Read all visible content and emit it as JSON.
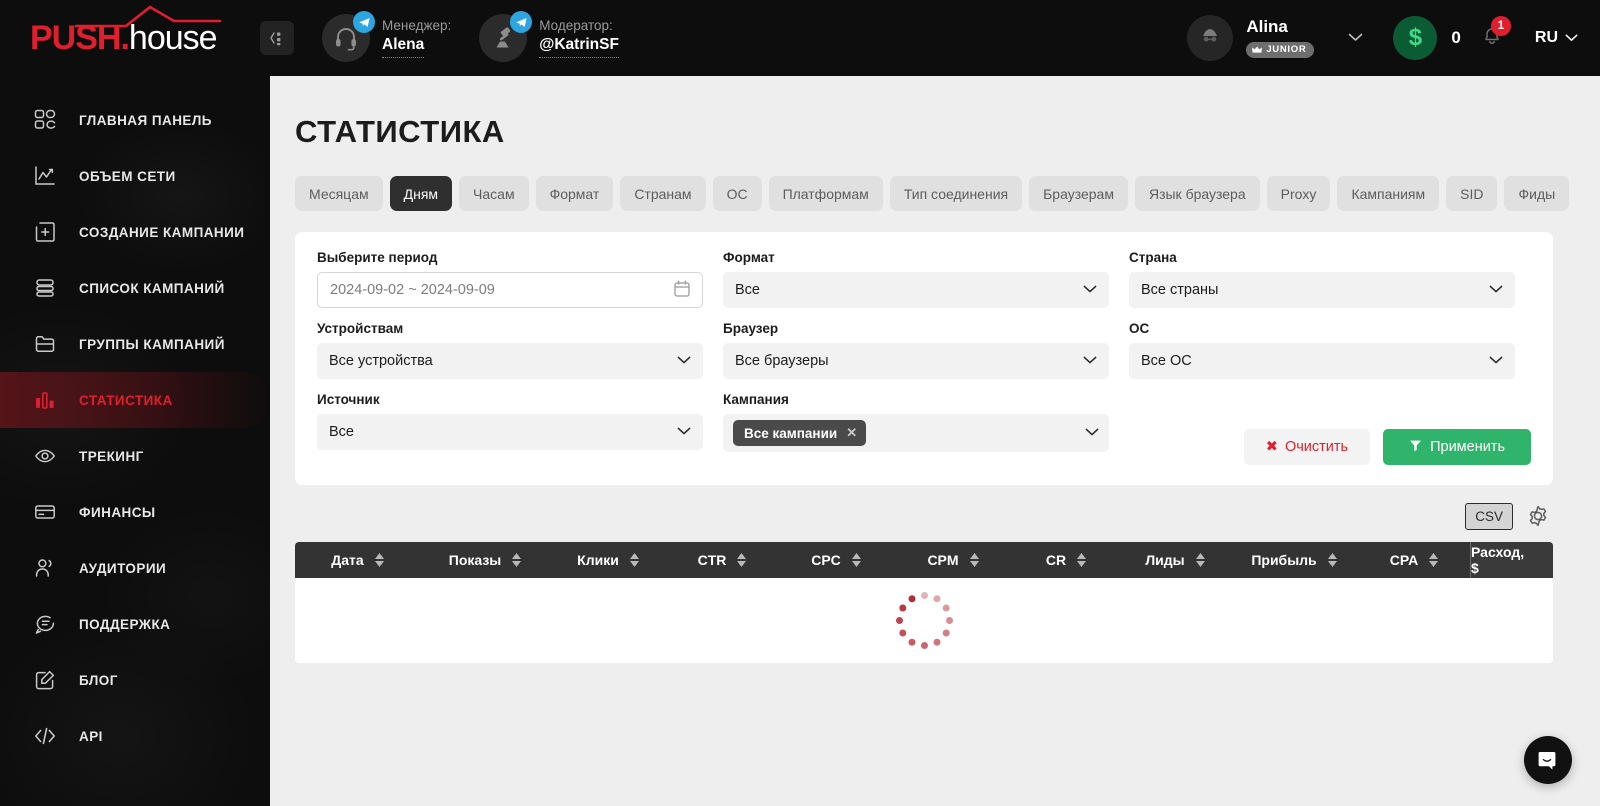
{
  "header": {
    "logo": {
      "push": "PUSH",
      "dot": ".",
      "house": "house"
    },
    "sidebar_toggle_icon": "sidebar-collapse-icon",
    "manager": {
      "role": "Менеджер:",
      "name": "Alena",
      "avatar_icon": "headset-icon",
      "badge_icon": "telegram-icon"
    },
    "moderator": {
      "role": "Модератор:",
      "name": "@KatrinSF",
      "avatar_icon": "gavel-icon",
      "badge_icon": "telegram-icon"
    },
    "user": {
      "name": "Alina",
      "rank_badge": "JUNIOR",
      "rank_icon": "crown-icon",
      "avatar_icon": "user-avatar-icon",
      "chevron_icon": "chevron-down-icon"
    },
    "balance": {
      "currency_symbol": "$",
      "amount": "0"
    },
    "notifications": {
      "count": "1",
      "icon": "bell-icon"
    },
    "language": {
      "value": "RU",
      "chevron_icon": "chevron-down-icon"
    }
  },
  "sidebar": {
    "items": [
      {
        "label": "ГЛАВНАЯ ПАНЕЛЬ",
        "icon": "dashboard-grid-icon",
        "active": false
      },
      {
        "label": "ОБЪЕМ СЕТИ",
        "icon": "network-volume-chart-icon",
        "active": false
      },
      {
        "label": "СОЗДАНИЕ КАМПАНИИ",
        "icon": "add-campaign-plus-icon",
        "active": false
      },
      {
        "label": "СПИСОК КАМПАНИЙ",
        "icon": "campaign-list-icon",
        "active": false
      },
      {
        "label": "ГРУППЫ КАМПАНИЙ",
        "icon": "folder-icon",
        "active": false
      },
      {
        "label": "СТАТИСТИКА",
        "icon": "bar-chart-icon",
        "active": true
      },
      {
        "label": "ТРЕКИНГ",
        "icon": "eye-icon",
        "active": false
      },
      {
        "label": "ФИНАНСЫ",
        "icon": "credit-card-icon",
        "active": false
      },
      {
        "label": "АУДИТОРИИ",
        "icon": "users-icon",
        "active": false
      },
      {
        "label": "ПОДДЕРЖКА",
        "icon": "support-chat-icon",
        "active": false
      },
      {
        "label": "БЛОГ",
        "icon": "edit-square-icon",
        "active": false
      },
      {
        "label": "API",
        "icon": "code-brackets-icon",
        "active": false
      }
    ]
  },
  "main": {
    "title": "СТАТИСТИКА",
    "tabs": [
      {
        "label": "Месяцам",
        "active": false
      },
      {
        "label": "Дням",
        "active": true
      },
      {
        "label": "Часам",
        "active": false
      },
      {
        "label": "Формат",
        "active": false
      },
      {
        "label": "Странам",
        "active": false
      },
      {
        "label": "ОС",
        "active": false
      },
      {
        "label": "Платформам",
        "active": false
      },
      {
        "label": "Тип соединения",
        "active": false
      },
      {
        "label": "Браузерам",
        "active": false
      },
      {
        "label": "Язык браузера",
        "active": false
      },
      {
        "label": "Proxy",
        "active": false
      },
      {
        "label": "Кампаниям",
        "active": false
      },
      {
        "label": "SID",
        "active": false
      },
      {
        "label": "Фиды",
        "active": false
      }
    ],
    "filters": {
      "period": {
        "label": "Выберите период",
        "value": "2024-09-02 ~ 2024-09-09",
        "icon": "calendar-icon"
      },
      "format": {
        "label": "Формат",
        "value": "Все"
      },
      "country": {
        "label": "Страна",
        "value": "Все страны"
      },
      "devices": {
        "label": "Устройствам",
        "value": "Все устройства"
      },
      "browser": {
        "label": "Браузер",
        "value": "Все браузеры"
      },
      "os": {
        "label": "ОС",
        "value": "Все ОС"
      },
      "source": {
        "label": "Источник",
        "value": "Все"
      },
      "campaign": {
        "label": "Кампания",
        "tag": "Все кампании",
        "remove_icon": "close-x-icon"
      },
      "clear_button": {
        "label": "Очистить",
        "icon": "x-icon",
        "color": "#e01f2e"
      },
      "apply_button": {
        "label": "Применить",
        "icon": "funnel-icon",
        "color": "#30b36a"
      }
    },
    "toolbar": {
      "csv_button": "CSV",
      "settings_icon": "gear-icon"
    },
    "table": {
      "columns": [
        {
          "label": "Дата",
          "sortable": true
        },
        {
          "label": "Показы",
          "sortable": true
        },
        {
          "label": "Клики",
          "sortable": true
        },
        {
          "label": "CTR",
          "sortable": true
        },
        {
          "label": "CPC",
          "sortable": true
        },
        {
          "label": "CPM",
          "sortable": true
        },
        {
          "label": "CR",
          "sortable": true
        },
        {
          "label": "Лиды",
          "sortable": true
        },
        {
          "label": "Прибыль",
          "sortable": true
        },
        {
          "label": "CPA",
          "sortable": true
        },
        {
          "label": "Расход, $",
          "sortable": false
        }
      ],
      "rows": [],
      "loading": true,
      "spinner_color": "#b0202d"
    }
  },
  "intercom": {
    "icon": "intercom-chat-icon"
  }
}
